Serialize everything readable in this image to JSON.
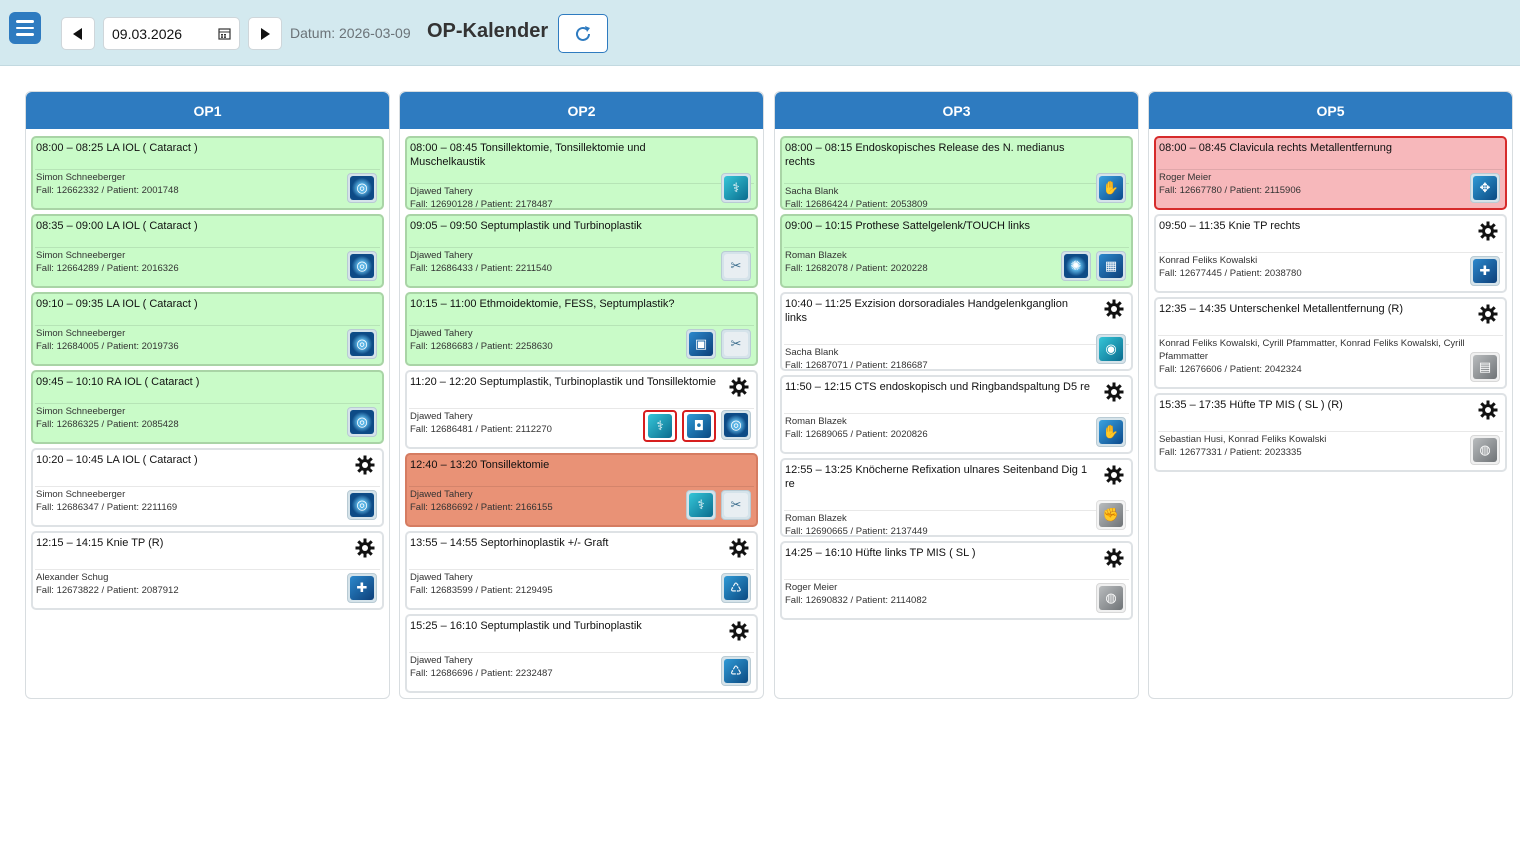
{
  "header": {
    "date_value": "09.03.2026",
    "datum_label": "Datum: 2026-03-09",
    "title": "OP-Kalender"
  },
  "rooms": [
    {
      "name": "OP1",
      "cards": [
        {
          "time_title": "08:00 – 08:25 LA IOL ( Cataract )",
          "surgeon": "Simon Schneeberger",
          "case": "Fall: 12662332 / Patient: 2001748"
        },
        {
          "time_title": "08:35 – 09:00 LA IOL ( Cataract )",
          "surgeon": "Simon Schneeberger",
          "case": "Fall: 12664289 / Patient: 2016326"
        },
        {
          "time_title": "09:10 – 09:35 LA IOL ( Cataract )",
          "surgeon": "Simon Schneeberger",
          "case": "Fall: 12684005 / Patient: 2019736"
        },
        {
          "time_title": "09:45 – 10:10 RA IOL ( Cataract )",
          "surgeon": "Simon Schneeberger",
          "case": "Fall: 12686325 / Patient: 2085428"
        },
        {
          "time_title": "10:20 – 10:45 LA IOL ( Cataract )",
          "surgeon": "Simon Schneeberger",
          "case": "Fall: 12686347 / Patient: 2211169"
        },
        {
          "time_title": "12:15 – 14:15 Knie TP (R)",
          "surgeon": "Alexander Schug",
          "case": "Fall: 12673822 / Patient: 2087912"
        }
      ]
    },
    {
      "name": "OP2",
      "cards": [
        {
          "time_title": "08:00 – 08:45 Tonsillektomie, Tonsillektomie und Muschelkaustik",
          "surgeon": "Djawed Tahery",
          "case": "Fall: 12690128 / Patient: 2178487"
        },
        {
          "time_title": "09:05 – 09:50 Septumplastik und Turbinoplastik",
          "surgeon": "Djawed Tahery",
          "case": "Fall: 12686433 / Patient: 2211540"
        },
        {
          "time_title": "10:15 – 11:00 Ethmoidektomie, FESS, Septumplastik?",
          "surgeon": "Djawed Tahery",
          "case": "Fall: 12686683 / Patient: 2258630"
        },
        {
          "time_title": "11:20 – 12:20 Septumplastik, Turbinoplastik und Tonsillektomie",
          "surgeon": "Djawed Tahery",
          "case": "Fall: 12686481 / Patient: 2112270"
        },
        {
          "time_title": "12:40 – 13:20 Tonsillektomie",
          "surgeon": "Djawed Tahery",
          "case": "Fall: 12686692 / Patient: 2166155"
        },
        {
          "time_title": "13:55 – 14:55 Septorhinoplastik +/- Graft",
          "surgeon": "Djawed Tahery",
          "case": "Fall: 12683599 / Patient: 2129495"
        },
        {
          "time_title": "15:25 – 16:10 Septumplastik und Turbinoplastik",
          "surgeon": "Djawed Tahery",
          "case": "Fall: 12686696 / Patient: 2232487"
        }
      ]
    },
    {
      "name": "OP3",
      "cards": [
        {
          "time_title": "08:00 – 08:15 Endoskopisches Release des N. medianus rechts",
          "surgeon": "Sacha Blank",
          "case": "Fall: 12686424 / Patient: 2053809"
        },
        {
          "time_title": "09:00 – 10:15 Prothese Sattelgelenk/TOUCH links",
          "surgeon": "Roman Blazek",
          "case": "Fall: 12682078 / Patient: 2020228"
        },
        {
          "time_title": "10:40 – 11:25 Exzision dorsoradiales Handgelenkganglion links",
          "surgeon": "Sacha Blank",
          "case": "Fall: 12687071 / Patient: 2186687"
        },
        {
          "time_title": "11:50 – 12:15 CTS endoskopisch und Ringbandspaltung D5 re",
          "surgeon": "Roman Blazek",
          "case": "Fall: 12689065 / Patient: 2020826"
        },
        {
          "time_title": "12:55 – 13:25 Knöcherne Refixation ulnares Seitenband Dig 1 re",
          "surgeon": "Roman Blazek",
          "case": "Fall: 12690665 / Patient: 2137449"
        },
        {
          "time_title": "14:25 – 16:10 Hüfte links TP MIS ( SL )",
          "surgeon": "Roger Meier",
          "case": "Fall: 12690832 / Patient: 2114082"
        }
      ]
    },
    {
      "name": "OP5",
      "cards": [
        {
          "time_title": "08:00 – 08:45 Clavicula rechts Metallentfernung",
          "surgeon": "Roger Meier",
          "case": "Fall: 12667780 / Patient: 2115906"
        },
        {
          "time_title": "09:50 – 11:35 Knie TP rechts",
          "surgeon": "Konrad Feliks Kowalski",
          "case": "Fall: 12677445 / Patient: 2038780"
        },
        {
          "time_title": "12:35 – 14:35 Unterschenkel Metallentfernung (R)",
          "surgeon": "Konrad Feliks Kowalski, Cyrill Pfammatter, Konrad Feliks Kowalski, Cyrill Pfammatter",
          "case": "Fall: 12676606 / Patient: 2042324"
        },
        {
          "time_title": "15:35 – 17:35 Hüfte TP MIS ( SL ) (R)",
          "surgeon": "Sebastian Husi, Konrad Feliks Kowalski",
          "case": "Fall: 12677331 / Patient: 2023335"
        }
      ]
    }
  ],
  "colors": {
    "header_bg": "#d3e9ef",
    "room_header": "#2e7bc0",
    "card_green": "#c9fbc8",
    "card_red": "#f7b8bb",
    "card_orange": "#e99276"
  }
}
